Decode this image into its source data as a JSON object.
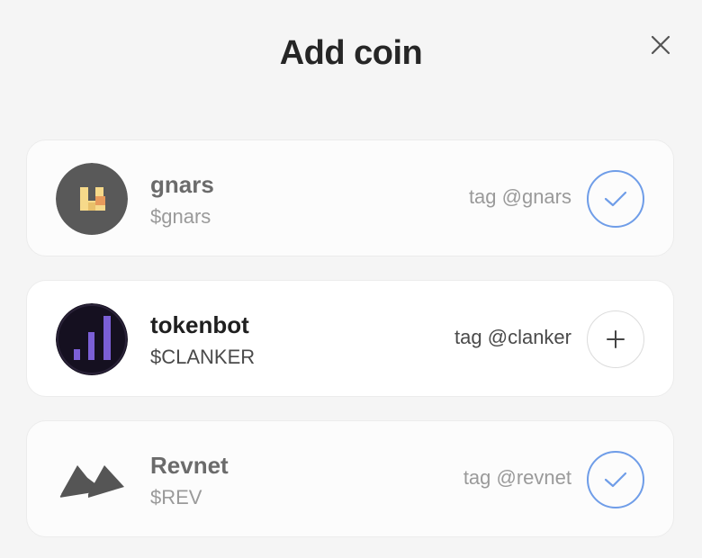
{
  "modal": {
    "title": "Add coin",
    "close_icon": "close-icon"
  },
  "coins": [
    {
      "name": "gnars",
      "symbol": "$gnars",
      "tag": "tag @gnars",
      "status": "added",
      "action_icon": "check-icon",
      "avatar_icon": "gnars-logo"
    },
    {
      "name": "tokenbot",
      "symbol": "$CLANKER",
      "tag": "tag @clanker",
      "status": "not-added",
      "action_icon": "plus-icon",
      "avatar_icon": "tokenbot-logo"
    },
    {
      "name": "Revnet",
      "symbol": "$REV",
      "tag": "tag @revnet",
      "status": "added",
      "action_icon": "check-icon",
      "avatar_icon": "revnet-logo"
    }
  ],
  "colors": {
    "check_accent": "#6f9de8",
    "title": "#262626",
    "muted_text": "#9a9a9a",
    "tokenbot_bars": "#7b5fd6"
  }
}
